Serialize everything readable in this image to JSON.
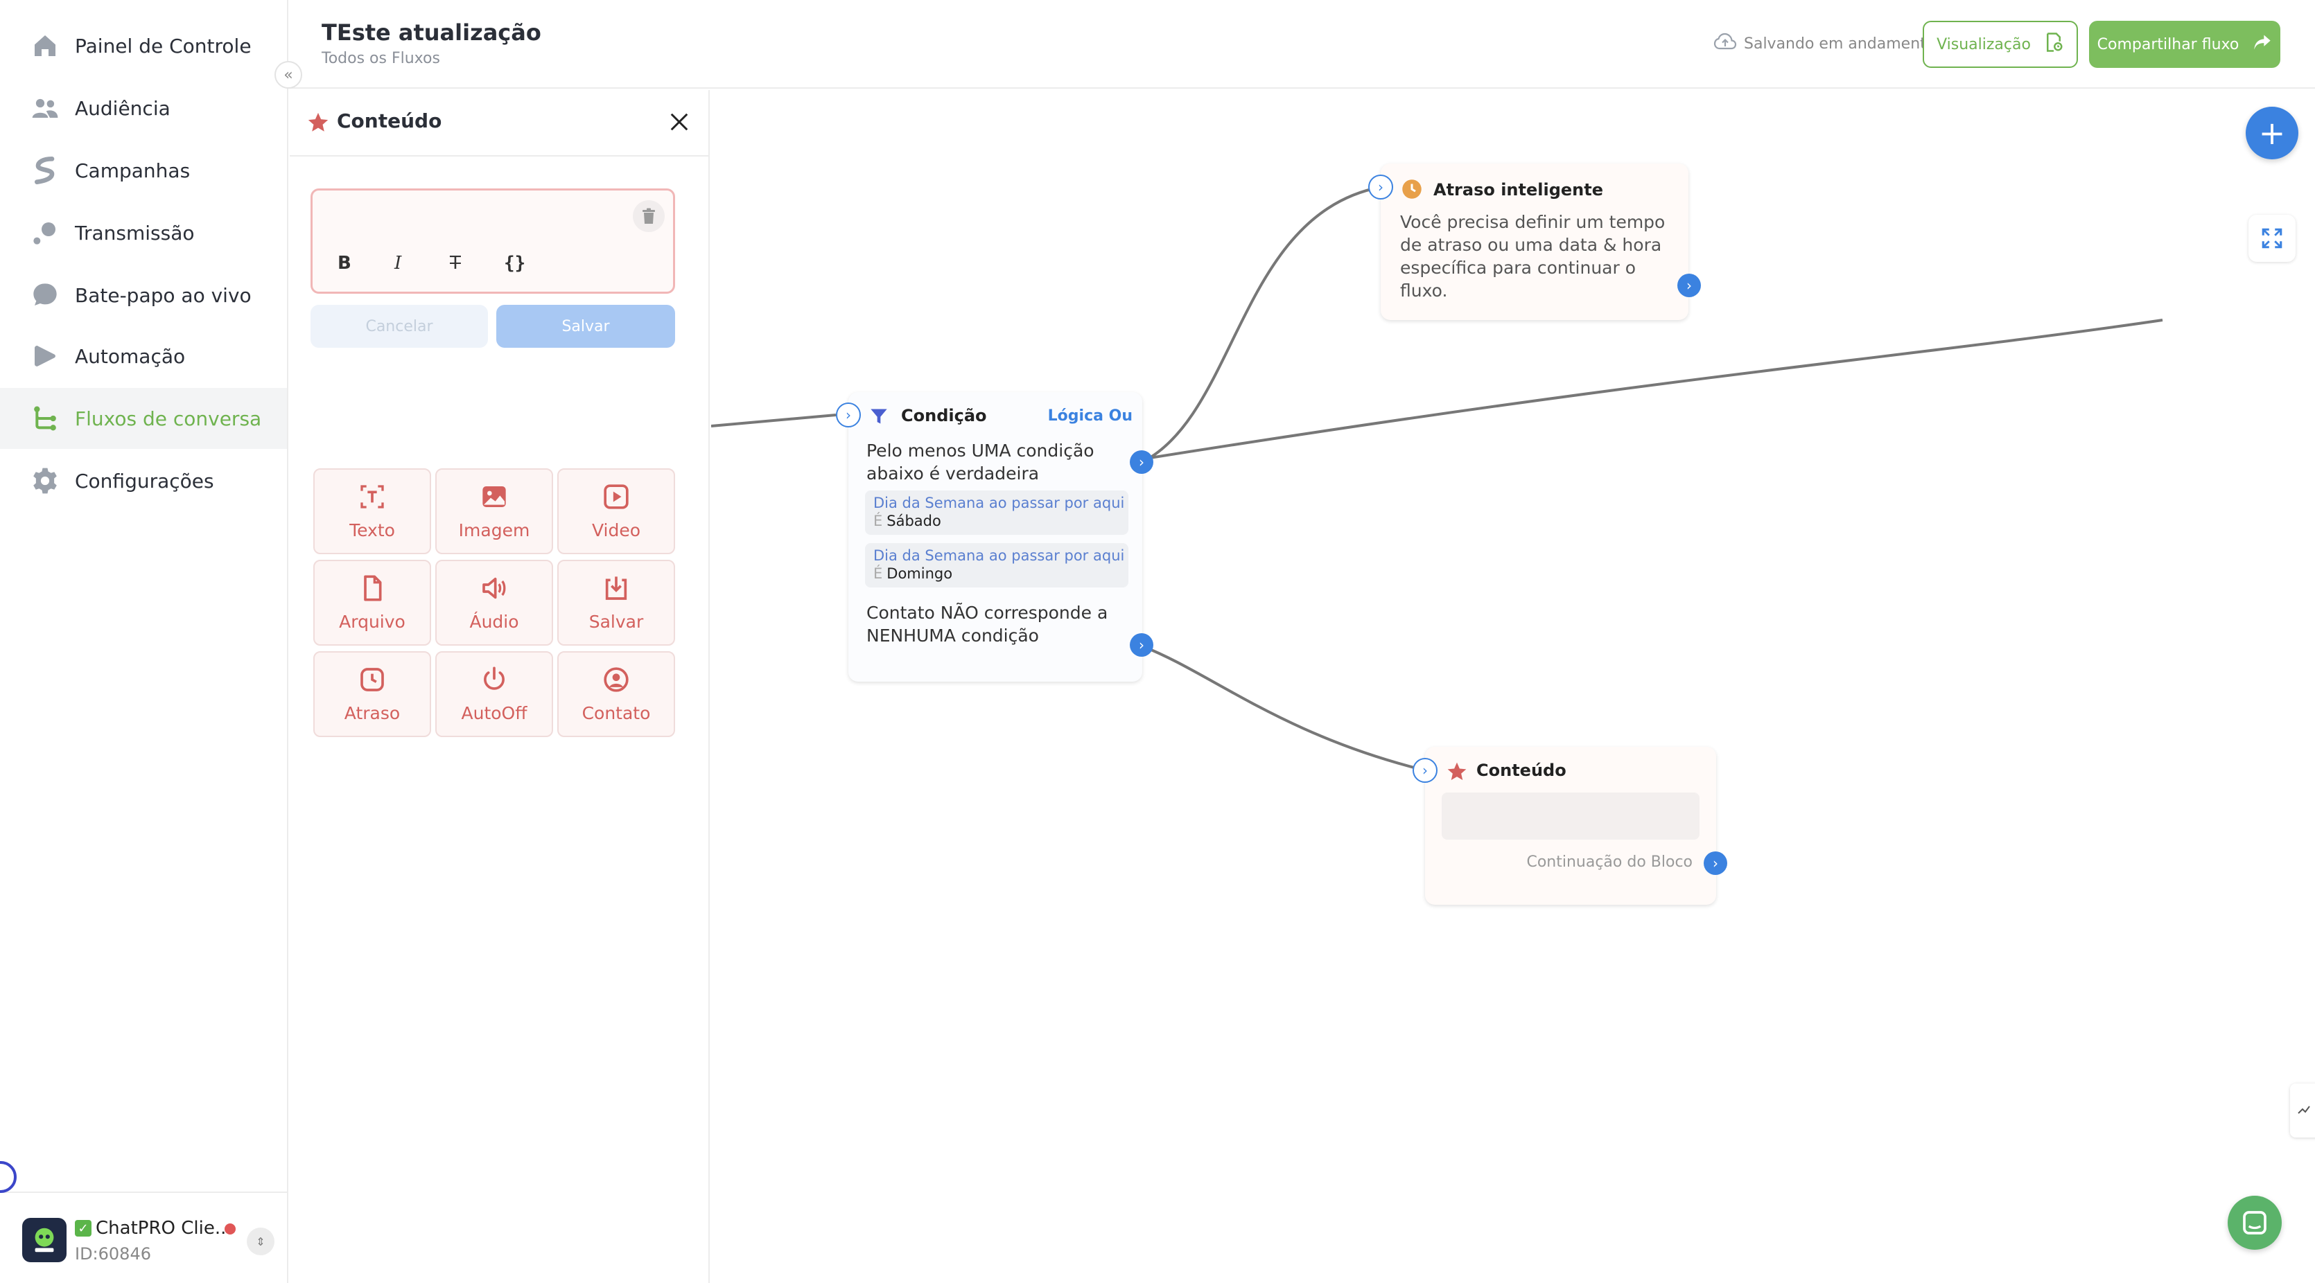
{
  "sidebar": {
    "items": [
      {
        "label": "Painel de Controle",
        "icon": "home-icon"
      },
      {
        "label": "Audiência",
        "icon": "users-icon"
      },
      {
        "label": "Campanhas",
        "icon": "campaign-icon"
      },
      {
        "label": "Transmissão",
        "icon": "broadcast-icon"
      },
      {
        "label": "Bate-papo ao vivo",
        "icon": "chat-icon"
      },
      {
        "label": "Automação",
        "icon": "automation-icon"
      },
      {
        "label": "Fluxos de conversa",
        "icon": "flow-icon",
        "active": true
      },
      {
        "label": "Configurações",
        "icon": "gear-icon"
      }
    ],
    "account": {
      "name": "ChatPRO Clie...",
      "id": "ID:60846"
    }
  },
  "header": {
    "title": "TEste atualização",
    "breadcrumb": "Todos os Fluxos",
    "saving_status": "Salvando em andamento",
    "preview_label": "Visualização",
    "share_label": "Compartilhar fluxo"
  },
  "panel": {
    "title": "Conteúdo",
    "format_buttons": [
      "B",
      "I",
      "T",
      "{}"
    ],
    "cancel_label": "Cancelar",
    "save_label": "Salvar",
    "tiles": [
      {
        "label": "Texto",
        "icon": "text-icon"
      },
      {
        "label": "Imagem",
        "icon": "image-icon"
      },
      {
        "label": "Video",
        "icon": "video-icon"
      },
      {
        "label": "Arquivo",
        "icon": "file-icon"
      },
      {
        "label": "Áudio",
        "icon": "audio-icon"
      },
      {
        "label": "Salvar",
        "icon": "save-download-icon"
      },
      {
        "label": "Atraso",
        "icon": "clock-icon"
      },
      {
        "label": "AutoOff",
        "icon": "power-icon"
      },
      {
        "label": "Contato",
        "icon": "contact-icon"
      }
    ]
  },
  "canvas": {
    "delay_node": {
      "title": "Atraso inteligente",
      "text": "Você precisa definir um tempo de atraso ou uma data & hora específica para continuar o fluxo."
    },
    "condition_node": {
      "title": "Condição",
      "logic_label": "Lógica Ou",
      "any_true_text": "Pelo menos UMA condição abaixo é verdadeira",
      "conditions": [
        {
          "label": "Dia da Semana ao passar por aqui",
          "operator": "É",
          "value": "Sábado"
        },
        {
          "label": "Dia da Semana ao passar por aqui",
          "operator": "É",
          "value": "Domingo"
        }
      ],
      "none_text": "Contato NÃO corresponde a NENHUMA condição"
    },
    "content_node": {
      "title": "Conteúdo",
      "continuation_label": "Continuação do Bloco"
    }
  },
  "colors": {
    "brand_green": "#6fb34f",
    "accent_blue": "#3b82e0",
    "danger_red": "#d3605d",
    "delay_orange": "#e8a04a"
  }
}
